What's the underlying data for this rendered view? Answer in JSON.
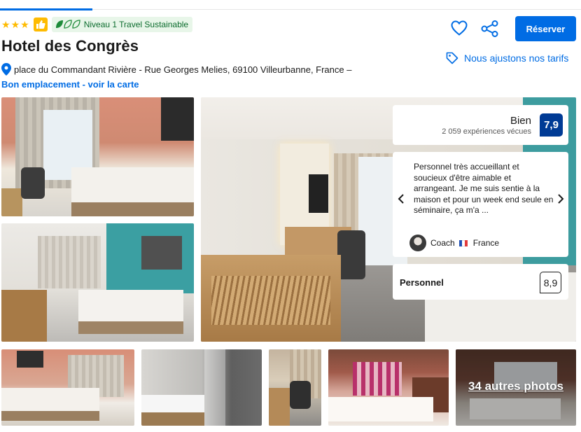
{
  "hotel": {
    "name": "Hotel des Congrès",
    "star_rating": 3,
    "sustainability_label": "Niveau 1 Travel Sustainable",
    "address": "place du Commandant Rivière - Rue Georges Melies, 69100 Villeurbanne, France –",
    "location_link": "Bon emplacement - voir la carte"
  },
  "actions": {
    "reserve_label": "Réserver",
    "price_match_label": "Nous ajustons nos tarifs"
  },
  "rating": {
    "word": "Bien",
    "score": "7,9",
    "review_count": "2 059 expériences vécues"
  },
  "featured_review": {
    "text": "Personnel très accueillant et soucieux d'être aimable et arrangeant. Je me suis sentie à la maison et pour un week end seule en séminaire, ça m'a ...",
    "reviewer_name": "Coach",
    "reviewer_country": "France"
  },
  "category_score": {
    "label": "Personnel",
    "score": "8,9"
  },
  "gallery": {
    "more_photos_label": "34 autres photos"
  },
  "colors": {
    "primary": "#006ce4",
    "score_badge": "#003b95",
    "star": "#febb02",
    "sustainable_bg": "#e8f6e9",
    "sustainable_text": "#0a6b2c"
  }
}
